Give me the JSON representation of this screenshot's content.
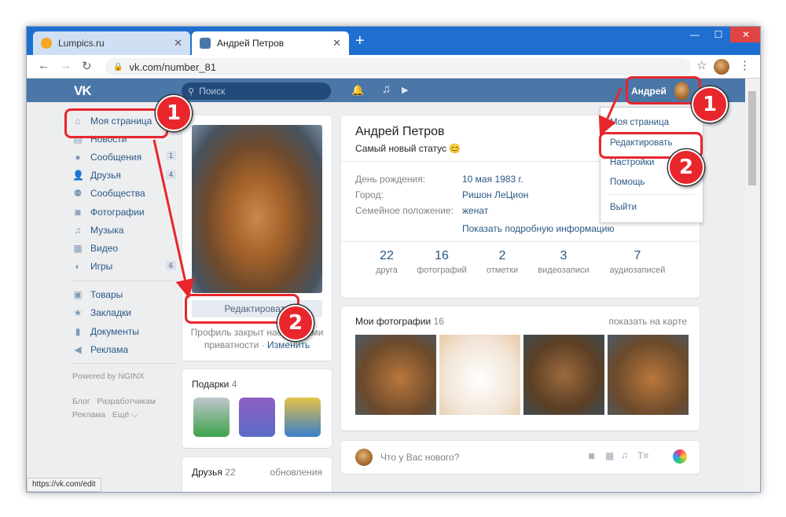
{
  "browser": {
    "tabs": [
      {
        "label": "Lumpics.ru"
      },
      {
        "label": "Андрей Петров"
      }
    ],
    "url": "vk.com/number_81",
    "status_url": "https://vk.com/edit"
  },
  "header": {
    "search_placeholder": "Поиск",
    "user_name": "Андрей"
  },
  "sidebar": {
    "items": [
      {
        "label": "Моя страница"
      },
      {
        "label": "Новости"
      },
      {
        "label": "Сообщения",
        "count": "1"
      },
      {
        "label": "Друзья",
        "count": "4"
      },
      {
        "label": "Сообщества"
      },
      {
        "label": "Фотографии"
      },
      {
        "label": "Музыка"
      },
      {
        "label": "Видео"
      },
      {
        "label": "Игры",
        "count": "6"
      }
    ],
    "items2": [
      {
        "label": "Товары"
      },
      {
        "label": "Закладки"
      },
      {
        "label": "Документы"
      },
      {
        "label": "Реклама"
      }
    ],
    "powered": "Powered by NGINX",
    "footer_links": [
      "Блог",
      "Разработчикам",
      "Реклама",
      "Ещё ⌵"
    ]
  },
  "profile": {
    "edit_button": "Редактировать",
    "closed_text": "Профиль закрыт настройками",
    "closed_text2": "приватности",
    "change_link": "Изменить",
    "gifts_title": "Подарки",
    "gifts_count": "4",
    "friends_title": "Друзья",
    "friends_count": "22",
    "friends_updates": "обновления"
  },
  "info": {
    "name": "Андрей Петров",
    "status": "Самый новый статус 😊",
    "rows": [
      {
        "label": "День рождения:",
        "value": "10 мая 1983 г."
      },
      {
        "label": "Город:",
        "value": "Ришон ЛеЦион"
      },
      {
        "label": "Семейное положение:",
        "value": "женат"
      }
    ],
    "more_link": "Показать подробную информацию",
    "stats": [
      {
        "n": "22",
        "l": "друга"
      },
      {
        "n": "16",
        "l": "фотографий"
      },
      {
        "n": "2",
        "l": "отметки"
      },
      {
        "n": "3",
        "l": "видеозаписи"
      },
      {
        "n": "7",
        "l": "аудиозаписей"
      }
    ]
  },
  "photos": {
    "title": "Мои фотографии",
    "count": "16",
    "map_link": "показать на карте"
  },
  "post": {
    "placeholder": "Что у Вас нового?"
  },
  "dropdown": {
    "items": [
      "Моя страница",
      "Редактировать",
      "Настройки",
      "Помощь",
      "Выйти"
    ]
  },
  "annotations": {
    "step1": "1",
    "step2": "2"
  },
  "colors": {
    "vk_blue": "#4a76a8",
    "annotation_red": "#e8262b"
  }
}
